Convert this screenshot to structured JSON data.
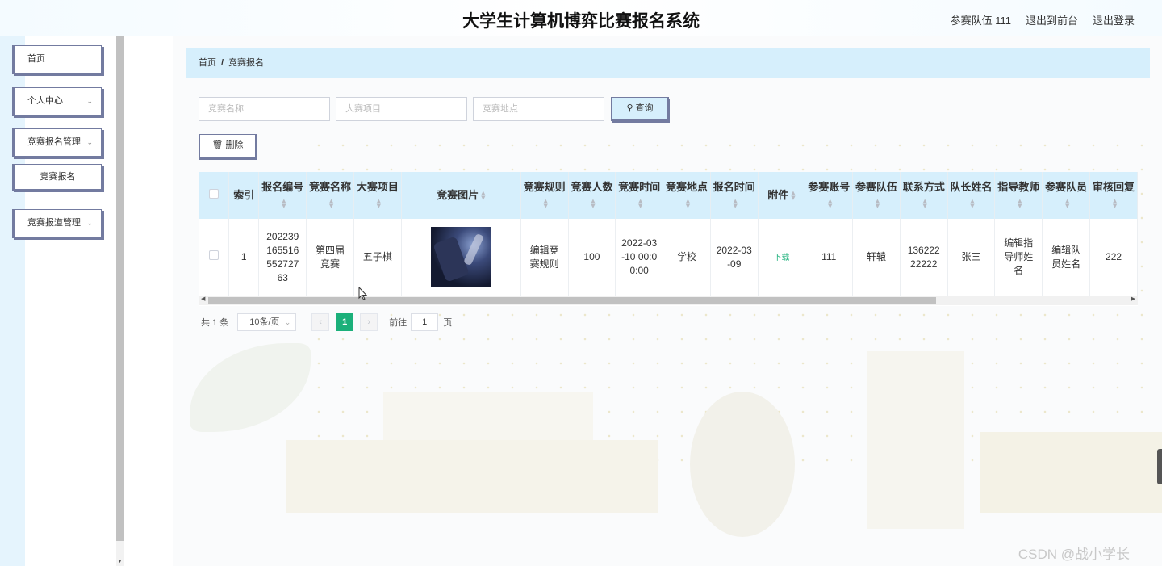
{
  "header": {
    "title": "大学生计算机博弈比赛报名系统",
    "user": "参赛队伍 111",
    "back_to_front": "退出到前台",
    "logout": "退出登录"
  },
  "sidebar": {
    "items": [
      {
        "label": "首页"
      },
      {
        "label": "个人中心"
      },
      {
        "label": "竞赛报名管理"
      },
      {
        "label": "竞赛报名"
      },
      {
        "label": "竞赛报道管理"
      }
    ]
  },
  "breadcrumb": {
    "home": "首页",
    "separator": "/",
    "current": "竞赛报名"
  },
  "search": {
    "name_placeholder": "竞赛名称",
    "project_placeholder": "大赛项目",
    "location_placeholder": "竞赛地点",
    "query_label": "查询"
  },
  "actions": {
    "delete_label": "删除"
  },
  "table": {
    "headers": [
      "索引",
      "报名编号",
      "竞赛名称",
      "大赛项目",
      "竞赛图片",
      "竞赛规则",
      "竞赛人数",
      "竞赛时间",
      "竞赛地点",
      "报名时间",
      "附件",
      "参赛账号",
      "参赛队伍",
      "联系方式",
      "队长姓名",
      "指导教师",
      "参赛队员",
      "审核回复"
    ],
    "row": {
      "index": "1",
      "reg_no": "20223916551655272763",
      "name": "第四届竞赛",
      "project": "五子棋",
      "rules": "编辑竞赛规则",
      "count": "100",
      "time": "2022-03-10 00:00:00",
      "location": "学校",
      "reg_time": "2022-03-09",
      "attachment": "下载",
      "account": "111",
      "team": "轩辕",
      "contact": "13622222222",
      "captain": "张三",
      "teacher": "编辑指导师姓名",
      "members": "编辑队员姓名",
      "reply": "222"
    }
  },
  "pagination": {
    "total": "共 1 条",
    "page_size": "10条/页",
    "current": "1",
    "goto_label": "前往",
    "goto_value": "1",
    "page_label": "页"
  },
  "watermark": "CSDN @战小学长"
}
